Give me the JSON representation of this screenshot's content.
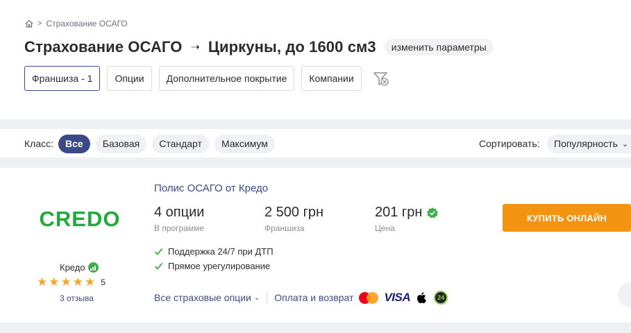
{
  "breadcrumb": {
    "home_icon": "home-icon",
    "item": "Страхование ОСАГО"
  },
  "header": {
    "title": "Страхование ОСАГО",
    "arrow": "➝",
    "vehicle": "Циркуны, до 1600 см3",
    "change_label": "изменить параметры"
  },
  "filters": [
    {
      "label": "Франшиза - 1",
      "active": true
    },
    {
      "label": "Опции",
      "active": false
    },
    {
      "label": "Дополнительное покрытие",
      "active": false
    },
    {
      "label": "Компании",
      "active": false
    }
  ],
  "class_bar": {
    "label": "Класс:",
    "options": [
      "Все",
      "Базовая",
      "Стандарт",
      "Максимум"
    ],
    "selected": "Все",
    "sort_label": "Сортировать:",
    "sort_value": "Популярность"
  },
  "offer": {
    "logo_text": "CREDO",
    "company": "Кредо",
    "rating": "5",
    "stars": 5,
    "reviews": "3 отзыва",
    "policy_title": "Полис ОСАГО от Кредо",
    "options_value": "4 опции",
    "options_label": "В программе",
    "franchise_value": "2 500 грн",
    "franchise_label": "Франшиза",
    "price_value": "201 грн",
    "price_label": "Цена",
    "buy_label": "КУПИТЬ ОНЛАЙН",
    "features": [
      "Поддержка 24/7 при ДТП",
      "Прямое урегулирование"
    ],
    "all_options_link": "Все страховые опции",
    "payment_label": "Оплата и возврат",
    "payment_icons": [
      "mastercard-icon",
      "visa-icon",
      "apple-pay-icon",
      "privat24-icon"
    ],
    "visa_text": "VISA",
    "p24_text": "24"
  },
  "colors": {
    "accent": "#3b4a86",
    "buy": "#f29312",
    "green": "#3fae49",
    "logo_green": "#1faa3a",
    "star": "#f6a623",
    "background_gap": "#eef0f4"
  }
}
